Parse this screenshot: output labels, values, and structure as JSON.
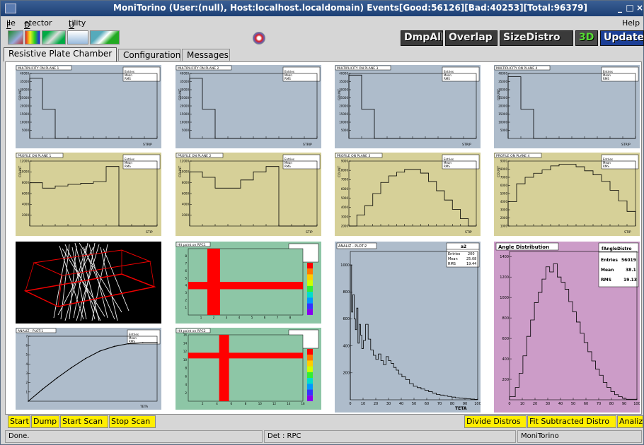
{
  "window": {
    "title": "MoniTorino (User:(null), Host:localhost.localdomain) Events[Good:56126][Bad:40253][Total:96379]",
    "controls": [
      "_",
      "□",
      "×"
    ]
  },
  "menu": {
    "file": "File",
    "detector": "Detector",
    "utility": "Utility",
    "help": "Help"
  },
  "toolbar": {
    "dmpall": "DmpAll",
    "overlap": "Overlap",
    "sizedistro": "SizeDistro",
    "threed": "3D",
    "update": "Update"
  },
  "tabs": [
    "Resistive Plate Chamber",
    "Configuration",
    "Messages"
  ],
  "pads": {
    "mult1": {
      "title": "MULTIPLICITY ON PLANE 1",
      "stats": [
        "Entries",
        "Mean",
        "RMS"
      ],
      "xlabel": "STRIP",
      "ylabel": "COUNT"
    },
    "mult2": {
      "title": "MULTIPLICITY ON PLANE 2",
      "stats": [
        "Entries",
        "Mean",
        "RMS"
      ],
      "xlabel": "STRIP",
      "ylabel": "COUNT"
    },
    "mult3": {
      "title": "MULTIPLICITY ON PLANE 3",
      "stats": [
        "Entries",
        "Mean",
        "RMS"
      ],
      "xlabel": "STRIP",
      "ylabel": "COUNT"
    },
    "mult4": {
      "title": "MULTIPLICITY ON PLANE 4",
      "stats": [
        "Entries",
        "Mean",
        "RMS"
      ],
      "xlabel": "STRIP",
      "ylabel": "COUNT"
    },
    "prof1": {
      "title": "PROFILE ON PLANE 1",
      "stats": [
        "Entries",
        "Mean",
        "RMS"
      ],
      "xlabel": "STIP",
      "ylabel": "COUNT"
    },
    "prof2": {
      "title": "PROFILE ON PLANE 2",
      "stats": [
        "Entries",
        "Mean",
        "RMS"
      ],
      "xlabel": "STIP",
      "ylabel": "COUNT"
    },
    "prof3": {
      "title": "PROFILE ON PLANE 3",
      "stats": [
        "Entries",
        "Mean",
        "RMS"
      ],
      "xlabel": "STIP",
      "ylabel": "COUNT"
    },
    "prof4": {
      "title": "PROFILE ON PLANE 4",
      "stats": [
        "Entries",
        "Mean",
        "RMS"
      ],
      "xlabel": "STIP",
      "ylabel": "COUNT"
    },
    "hit1": {
      "title": "Hit point on RPC1"
    },
    "hit2": {
      "title": "Hit point on RPC2"
    },
    "plot1": {
      "title": "ANALIZ - PLOT:1",
      "xlabel": "TETA",
      "stats": [
        "Entries",
        "Mean",
        "RMS"
      ]
    },
    "plot2": {
      "title": "ANALIZ - PLOT:2",
      "xlabel": "TETA",
      "stat_title": "a2",
      "stats": [
        {
          "k": "Entries",
          "v": "200"
        },
        {
          "k": "Mean",
          "v": "25.08"
        },
        {
          "k": "RMS",
          "v": "19.44"
        }
      ]
    },
    "angle": {
      "title": "Angle Distribution",
      "stat_title": "fAngleDistro",
      "stats": [
        {
          "k": "Entries",
          "v": "56019"
        },
        {
          "k": "Mean",
          "v": "38.1"
        },
        {
          "k": "RMS",
          "v": "19.13"
        }
      ]
    }
  },
  "chart_data": [
    {
      "type": "bar",
      "title": "MULTIPLICITY ON PLANE 1",
      "xlabel": "STRIP",
      "ylabel": "COUNT",
      "ylim": [
        0,
        40000
      ],
      "y_ticks": [
        5000,
        10000,
        15000,
        20000,
        25000,
        30000,
        35000,
        40000
      ],
      "categories": [
        1,
        2,
        3
      ],
      "values": [
        37000,
        18000,
        0
      ]
    },
    {
      "type": "bar",
      "title": "MULTIPLICITY ON PLANE 2",
      "xlabel": "STRIP",
      "ylabel": "COUNT",
      "ylim": [
        0,
        40000
      ],
      "y_ticks": [
        5000,
        10000,
        15000,
        20000,
        25000,
        30000,
        35000,
        40000
      ],
      "categories": [
        1,
        2,
        3
      ],
      "values": [
        37000,
        18000,
        0
      ]
    },
    {
      "type": "bar",
      "title": "MULTIPLICITY ON PLANE 3",
      "xlabel": "STRIP",
      "ylabel": "COUNT",
      "ylim": [
        0,
        40000
      ],
      "y_ticks": [
        5000,
        10000,
        15000,
        20000,
        25000,
        30000,
        35000,
        40000
      ],
      "categories": [
        1,
        2,
        3
      ],
      "values": [
        39000,
        18000,
        0
      ]
    },
    {
      "type": "bar",
      "title": "MULTIPLICITY ON PLANE 4",
      "xlabel": "STRIP",
      "ylabel": "COUNT",
      "ylim": [
        0,
        40000
      ],
      "y_ticks": [
        5000,
        10000,
        15000,
        20000,
        25000,
        30000,
        35000,
        40000
      ],
      "categories": [
        1,
        2,
        3
      ],
      "values": [
        38000,
        18000,
        0
      ]
    },
    {
      "type": "bar",
      "title": "PROFILE ON PLANE 1",
      "xlabel": "STIP",
      "ylabel": "COUNT",
      "ylim": [
        0,
        12000
      ],
      "y_ticks": [
        2000,
        4000,
        6000,
        8000,
        10000,
        12000
      ],
      "values": [
        8000,
        7000,
        7400,
        7700,
        7900,
        8200,
        11000,
        0,
        0,
        0
      ]
    },
    {
      "type": "bar",
      "title": "PROFILE ON PLANE 2",
      "xlabel": "STIP",
      "ylabel": "COUNT",
      "ylim": [
        0,
        12000
      ],
      "y_ticks": [
        2000,
        4000,
        6000,
        8000,
        10000,
        12000
      ],
      "values": [
        10000,
        9000,
        7000,
        7000,
        8500,
        10000,
        11000,
        0,
        0,
        0
      ]
    },
    {
      "type": "bar",
      "title": "PROFILE ON PLANE 3",
      "xlabel": "STIP",
      "ylabel": "COUNT",
      "ylim": [
        2000,
        9000
      ],
      "y_ticks": [
        2000,
        3000,
        4000,
        5000,
        6000,
        7000,
        8000,
        9000
      ],
      "values": [
        2000,
        3200,
        4200,
        5500,
        6700,
        7400,
        7800,
        8100,
        8100,
        7700,
        6800,
        5800,
        4800,
        3800,
        2800,
        2000
      ]
    },
    {
      "type": "bar",
      "title": "PROFILE ON PLANE 4",
      "xlabel": "STIP",
      "ylabel": "COUNT",
      "ylim": [
        1000,
        9000
      ],
      "y_ticks": [
        1000,
        2000,
        3000,
        4000,
        5000,
        6000,
        7000,
        8000,
        9000
      ],
      "values": [
        4000,
        6200,
        7000,
        7500,
        7900,
        8400,
        8600,
        8600,
        8300,
        7800,
        7300,
        6500,
        5400,
        4100,
        2800
      ]
    },
    {
      "type": "heatmap",
      "title": "Hit point on RPC1",
      "x_ticks": [
        1,
        2,
        3,
        4,
        5,
        6,
        7,
        8
      ],
      "y_ticks": [
        1,
        2,
        3,
        4,
        5,
        6,
        7,
        8
      ],
      "hit_column": 2,
      "hit_row": 4,
      "xlim": [
        0,
        9
      ],
      "ylim": [
        0,
        9
      ]
    },
    {
      "type": "heatmap",
      "title": "Hit point on RPC2",
      "x_ticks": [
        2,
        4,
        6,
        8,
        10,
        12,
        14,
        16
      ],
      "y_ticks": [
        2,
        4,
        6,
        8,
        10,
        12,
        14,
        16
      ],
      "hit_column": 5,
      "hit_row": 11,
      "xlim": [
        0,
        16
      ],
      "ylim": [
        0,
        16
      ]
    },
    {
      "type": "line",
      "title": "ANALIZ - PLOT:1",
      "xlabel": "TETA",
      "ylim": [
        0,
        7
      ],
      "y_ticks": [
        1,
        2,
        3,
        4,
        5,
        6,
        7
      ],
      "x": [
        0,
        20,
        40,
        60,
        80,
        100,
        120,
        140,
        160,
        180
      ],
      "values": [
        0,
        1.3,
        2.5,
        3.6,
        4.6,
        5.4,
        5.9,
        6.2,
        6.3,
        6.3
      ]
    },
    {
      "type": "bar",
      "title": "ANALIZ - PLOT:2",
      "xlabel": "TETA",
      "xlim": [
        0,
        100
      ],
      "ylim": [
        0,
        1100
      ],
      "x_ticks": [
        0,
        10,
        20,
        30,
        40,
        50,
        60,
        70,
        80,
        90,
        100
      ],
      "y_ticks": [
        200,
        400,
        600,
        800,
        1000
      ],
      "x": [
        0.5,
        1.5,
        2.5,
        3.5,
        4.5,
        5.5,
        6.5,
        7.5,
        8.5,
        9.5,
        11,
        13,
        15,
        17,
        19,
        21,
        23,
        25,
        27,
        29,
        31,
        33,
        35,
        37,
        39,
        42,
        45,
        48,
        51,
        54,
        57,
        60,
        63,
        66,
        69,
        72,
        75,
        78,
        81,
        84,
        87,
        90,
        93,
        96,
        99
      ],
      "values": [
        1000,
        650,
        780,
        600,
        520,
        680,
        420,
        560,
        480,
        380,
        440,
        560,
        450,
        370,
        330,
        300,
        340,
        290,
        260,
        320,
        290,
        270,
        240,
        220,
        190,
        170,
        150,
        120,
        100,
        90,
        80,
        70,
        60,
        50,
        40,
        35,
        30,
        25,
        20,
        15,
        12,
        10,
        8,
        5,
        3
      ]
    },
    {
      "type": "bar",
      "title": "Angle Distribution",
      "xlabel": "",
      "xlim": [
        0,
        100
      ],
      "ylim": [
        0,
        1450
      ],
      "x_ticks": [
        0,
        10,
        20,
        30,
        40,
        50,
        60,
        70,
        80,
        90,
        100
      ],
      "y_ticks": [
        200,
        400,
        600,
        800,
        1000,
        1200,
        1400
      ],
      "x": [
        3,
        6,
        9,
        12,
        15,
        18,
        21,
        24,
        27,
        30,
        33,
        36,
        39,
        42,
        45,
        48,
        51,
        54,
        57,
        60,
        63,
        66,
        69,
        72,
        75,
        78,
        81,
        84,
        87,
        90,
        93
      ],
      "values": [
        30,
        120,
        260,
        430,
        620,
        780,
        950,
        1050,
        1180,
        1300,
        1250,
        1330,
        1200,
        1150,
        1080,
        960,
        860,
        760,
        650,
        560,
        470,
        380,
        300,
        240,
        170,
        120,
        80,
        50,
        30,
        15,
        5
      ]
    }
  ],
  "bottom_buttons_left": [
    "Start",
    "Dump",
    "Start Scan",
    "Stop Scan"
  ],
  "bottom_buttons_right": [
    "Divide Distros",
    "Fit Subtracted Distro",
    "Analiz"
  ],
  "status": {
    "left": "Done.",
    "middle": "Det : RPC",
    "right": "MoniTorino"
  }
}
